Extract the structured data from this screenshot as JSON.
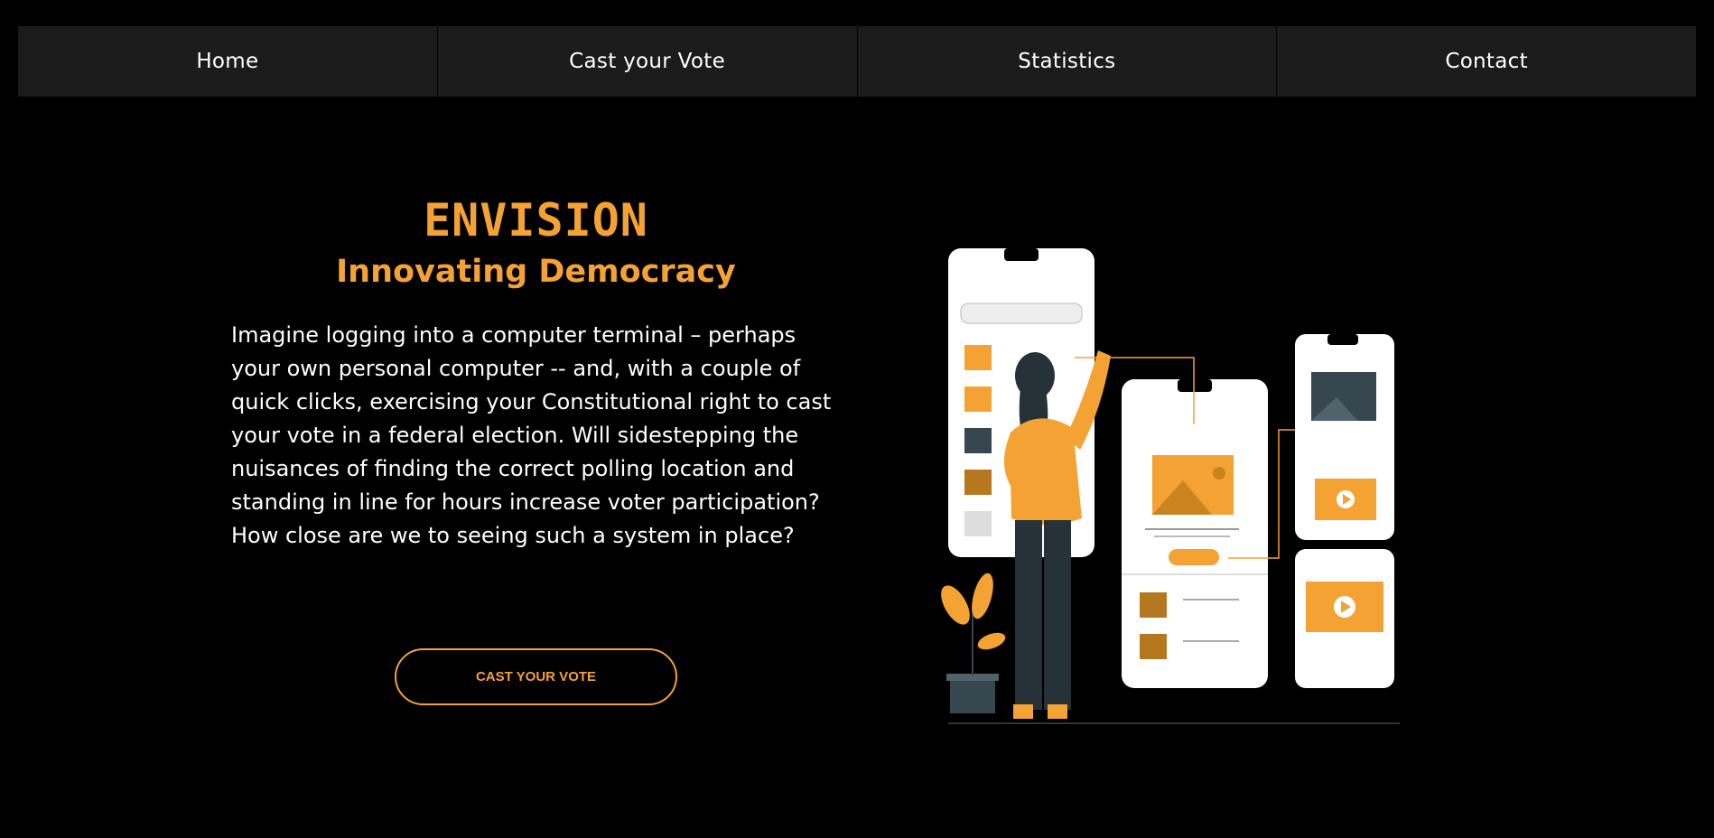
{
  "nav": {
    "items": [
      {
        "label": "Home"
      },
      {
        "label": "Cast your Vote"
      },
      {
        "label": "Statistics"
      },
      {
        "label": "Contact"
      }
    ]
  },
  "hero": {
    "title": "ENVISION",
    "subtitle": "Innovating Democracy",
    "body": "Imagine logging into a computer terminal – perhaps your own personal computer -- and, with a couple of quick clicks, exercising your Constitutional right to cast your vote in a federal election. Will sidestepping the nuisances of finding the correct polling location and standing in line for hours increase voter participation? How close are we to seeing such a system in place?",
    "cta_label": "CAST YOUR VOTE"
  },
  "colors": {
    "accent": "#f5a234",
    "background": "#000000",
    "nav_bg": "#1b1b1b"
  },
  "illustration": {
    "icon": "woman-with-phone-screens-illustration"
  }
}
